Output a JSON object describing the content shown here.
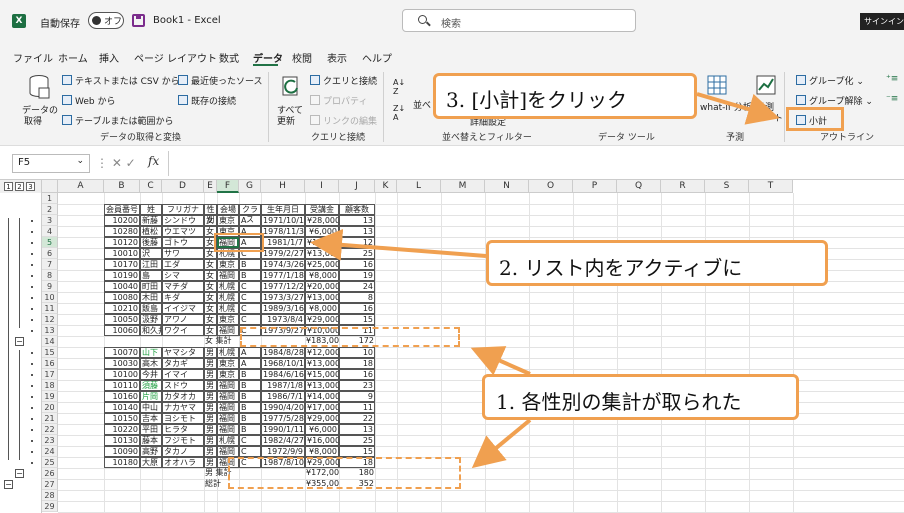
{
  "titlebar": {
    "app_icon": "X",
    "autosave_label": "自動保存",
    "autosave_state": "オフ",
    "document_title": "Book1  -  Excel",
    "search_placeholder": "検索",
    "signin_label": "サインイン"
  },
  "menu": {
    "tabs": [
      {
        "label": "ファイル"
      },
      {
        "label": "ホーム"
      },
      {
        "label": "挿入"
      },
      {
        "label": "ページ レイアウト"
      },
      {
        "label": "数式"
      },
      {
        "label": "データ",
        "active": true
      },
      {
        "label": "校閲"
      },
      {
        "label": "表示"
      },
      {
        "label": "ヘルプ"
      }
    ]
  },
  "ribbon": {
    "get_data_label": "データの",
    "get_data_label2": "取得",
    "text_csv": "テキストまたは CSV から",
    "from_web": "Web から",
    "from_table": "テーブルまたは範囲から",
    "recent_sources": "最近使ったソース",
    "existing_connections": "既存の接続",
    "group_get_transform": "データの取得と変換",
    "refresh_all": "すべて",
    "refresh_all2": "更新",
    "queries_connections": "クエリと接続",
    "properties": "プロパティ",
    "edit_links": "リンクの編集",
    "group_queries": "クエリと接続",
    "sort_label": "並べ",
    "advanced": "詳細設定",
    "group_sort_filter": "並べ替えとフィルター",
    "group_data_tools": "データ ツール",
    "whatif_label": "what-if 分析",
    "forecast_label": "予測",
    "forecast_label2": "シート",
    "group_forecast": "予測",
    "group_label": "グループ化",
    "ungroup_label": "グループ解除",
    "subtotal_label": "小計",
    "group_outline": "アウトライン"
  },
  "formula_bar": {
    "name_box": "F5",
    "fx": "fx"
  },
  "sheet": {
    "outline_levels": [
      "1",
      "2",
      "3"
    ],
    "columns": [
      "A",
      "B",
      "C",
      "D",
      "E",
      "F",
      "G",
      "H",
      "I",
      "J",
      "K",
      "L",
      "M",
      "N",
      "O",
      "P",
      "Q",
      "R",
      "S",
      "T"
    ],
    "row_numbers": [
      "1",
      "2",
      "3",
      "4",
      "5",
      "6",
      "7",
      "8",
      "9",
      "10",
      "11",
      "12",
      "13",
      "14",
      "15",
      "16",
      "17",
      "18",
      "19",
      "20",
      "21",
      "22",
      "23",
      "24",
      "25",
      "26",
      "27",
      "28",
      "29"
    ],
    "table_headers": [
      "会員番号",
      "姓",
      "フリガナ",
      "性別",
      "会場",
      "クラス",
      "生年月日",
      "受講金",
      "顧客数"
    ],
    "rows": [
      {
        "id": "10200",
        "sei": "新藤",
        "kana": "シンドウ",
        "sex": "女",
        "venue": "東京",
        "cls": "A",
        "dob": "1971/10/15",
        "fee": "¥28,000",
        "cnt": "13"
      },
      {
        "id": "10280",
        "sei": "植松",
        "kana": "ウエマツ",
        "sex": "女",
        "venue": "東京",
        "cls": "A",
        "dob": "1978/11/30",
        "fee": "¥6,000",
        "cnt": "13"
      },
      {
        "id": "10120",
        "sei": "後藤",
        "kana": "ゴトウ",
        "sex": "女",
        "venue": "福岡",
        "cls": "A",
        "dob": "1981/1/7",
        "fee": "¥17,000",
        "cnt": "12"
      },
      {
        "id": "10010",
        "sei": "沢",
        "kana": "サワ",
        "sex": "女",
        "venue": "札幌",
        "cls": "C",
        "dob": "1979/2/27",
        "fee": "¥13,000",
        "cnt": "25"
      },
      {
        "id": "10170",
        "sei": "江田",
        "kana": "エダ",
        "sex": "女",
        "venue": "東京",
        "cls": "B",
        "dob": "1974/3/26",
        "fee": "¥25,000",
        "cnt": "16"
      },
      {
        "id": "10190",
        "sei": "島",
        "kana": "シマ",
        "sex": "女",
        "venue": "福岡",
        "cls": "B",
        "dob": "1977/1/18",
        "fee": "¥8,000",
        "cnt": "19"
      },
      {
        "id": "10040",
        "sei": "町田",
        "kana": "マチダ",
        "sex": "女",
        "venue": "札幌",
        "cls": "C",
        "dob": "1977/12/2",
        "fee": "¥20,000",
        "cnt": "24"
      },
      {
        "id": "10080",
        "sei": "木田",
        "kana": "キダ",
        "sex": "女",
        "venue": "札幌",
        "cls": "C",
        "dob": "1973/3/27",
        "fee": "¥13,000",
        "cnt": "8"
      },
      {
        "id": "10210",
        "sei": "飯島",
        "kana": "イイジマ",
        "sex": "女",
        "venue": "札幌",
        "cls": "C",
        "dob": "1989/3/16",
        "fee": "¥8,000",
        "cnt": "16"
      },
      {
        "id": "10050",
        "sei": "汲野",
        "kana": "アワノ",
        "sex": "女",
        "venue": "東京",
        "cls": "C",
        "dob": "1973/8/4",
        "fee": "¥29,000",
        "cnt": "15"
      },
      {
        "id": "10060",
        "sei": "和久井",
        "kana": "ワクイ",
        "sex": "女",
        "venue": "福岡",
        "cls": "C",
        "dob": "1973/9/27",
        "fee": "¥10,000",
        "cnt": "11"
      },
      {
        "subtotal": true,
        "label": "女 集計",
        "fee": "¥183,000",
        "cnt": "172"
      },
      {
        "id": "10070",
        "sei": "山下",
        "kana": "ヤマシタ",
        "sex": "男",
        "venue": "札幌",
        "cls": "A",
        "dob": "1984/8/28",
        "fee": "¥12,000",
        "cnt": "10",
        "green": true
      },
      {
        "id": "10030",
        "sei": "高木",
        "kana": "タカギ",
        "sex": "男",
        "venue": "東京",
        "cls": "A",
        "dob": "1968/10/19",
        "fee": "¥13,000",
        "cnt": "18"
      },
      {
        "id": "10100",
        "sei": "今井",
        "kana": "イマイ",
        "sex": "男",
        "venue": "東京",
        "cls": "B",
        "dob": "1984/6/16",
        "fee": "¥15,000",
        "cnt": "16"
      },
      {
        "id": "10110",
        "sei": "須藤",
        "kana": "スドウ",
        "sex": "男",
        "venue": "福岡",
        "cls": "B",
        "dob": "1987/1/8",
        "fee": "¥13,000",
        "cnt": "23",
        "green": true
      },
      {
        "id": "10160",
        "sei": "片岡",
        "kana": "カタオカ",
        "sex": "男",
        "venue": "福岡",
        "cls": "B",
        "dob": "1986/7/1",
        "fee": "¥14,000",
        "cnt": "9",
        "green": true
      },
      {
        "id": "10140",
        "sei": "中山",
        "kana": "ナカヤマ",
        "sex": "男",
        "venue": "福岡",
        "cls": "B",
        "dob": "1990/4/20",
        "fee": "¥17,000",
        "cnt": "11"
      },
      {
        "id": "10150",
        "sei": "吉本",
        "kana": "ヨシモト",
        "sex": "男",
        "venue": "福岡",
        "cls": "B",
        "dob": "1977/5/28",
        "fee": "¥29,000",
        "cnt": "22"
      },
      {
        "id": "10220",
        "sei": "平田",
        "kana": "ヒラタ",
        "sex": "男",
        "venue": "福岡",
        "cls": "B",
        "dob": "1990/1/11",
        "fee": "¥6,000",
        "cnt": "13"
      },
      {
        "id": "10130",
        "sei": "藤本",
        "kana": "フジモト",
        "sex": "男",
        "venue": "札幌",
        "cls": "C",
        "dob": "1982/4/27",
        "fee": "¥16,000",
        "cnt": "25"
      },
      {
        "id": "10090",
        "sei": "高野",
        "kana": "タカノ",
        "sex": "男",
        "venue": "福岡",
        "cls": "C",
        "dob": "1972/9/9",
        "fee": "¥8,000",
        "cnt": "15"
      },
      {
        "id": "10180",
        "sei": "大原",
        "kana": "オオハラ",
        "sex": "男",
        "venue": "福岡",
        "cls": "C",
        "dob": "1987/8/10",
        "fee": "¥29,000",
        "cnt": "18"
      },
      {
        "subtotal": true,
        "label": "男 集計",
        "fee": "¥172,000",
        "cnt": "180"
      },
      {
        "subtotal": true,
        "label": "総計",
        "fee": "¥355,000",
        "cnt": "352"
      }
    ]
  },
  "callouts": {
    "step1": "1. 各性別の集計が取られた",
    "step2": "2. リスト内をアクティブに",
    "step3": "3. [小計]をクリック"
  },
  "colors": {
    "excel_green": "#217346",
    "callout_orange": "#f0a050",
    "accent_purple": "#7b2c8c"
  }
}
